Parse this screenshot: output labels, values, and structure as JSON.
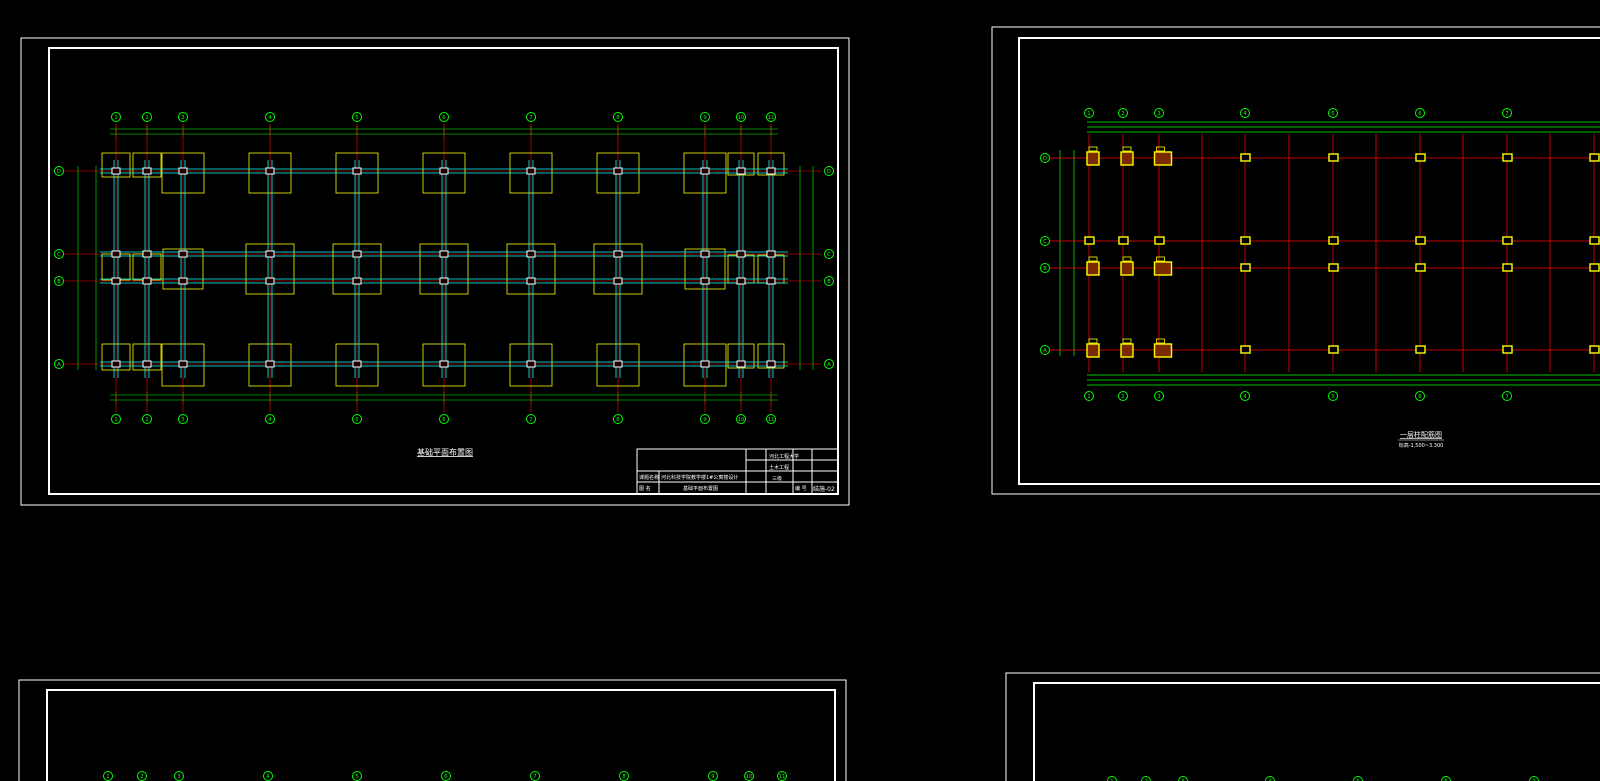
{
  "sheet1": {
    "title": "基础平面布置图",
    "axes_top": [
      "1",
      "2",
      "3",
      "4",
      "5",
      "6",
      "7",
      "8",
      "9",
      "10",
      "11"
    ],
    "axes_side": [
      "D",
      "C",
      "B",
      "A"
    ],
    "title_block": {
      "school": "河北工程大学",
      "dept": "土木工程",
      "grade": "三级",
      "project_label": "课题名称",
      "project_name": "河北科技学院教学楼1#公寓楼设计",
      "drawing_label": "图 名",
      "drawing_name": "基础平面布置图",
      "number_label": "编 号",
      "number": "结施-02"
    }
  },
  "sheet2": {
    "title": "一层柱配筋图",
    "subtitle": "标高-1.500~3.300",
    "axes_top": [
      "1",
      "2",
      "3",
      "4",
      "5",
      "6",
      "7"
    ],
    "axes_side": [
      "D",
      "C",
      "B",
      "A"
    ]
  },
  "sheet3": {
    "axes_top": [
      "1",
      "2",
      "3",
      "4",
      "5",
      "6",
      "7",
      "8",
      "9",
      "10",
      "11"
    ]
  },
  "sheet4": {
    "axes_top": [
      "1",
      "2",
      "3",
      "4",
      "5",
      "6",
      "7"
    ]
  },
  "colors": {
    "frame": "#ffffff",
    "axis": "#00ff00",
    "footing": "#ffff00",
    "beam": "#00ffff",
    "grid_red": "#ff0000",
    "column": "#ffff00"
  }
}
